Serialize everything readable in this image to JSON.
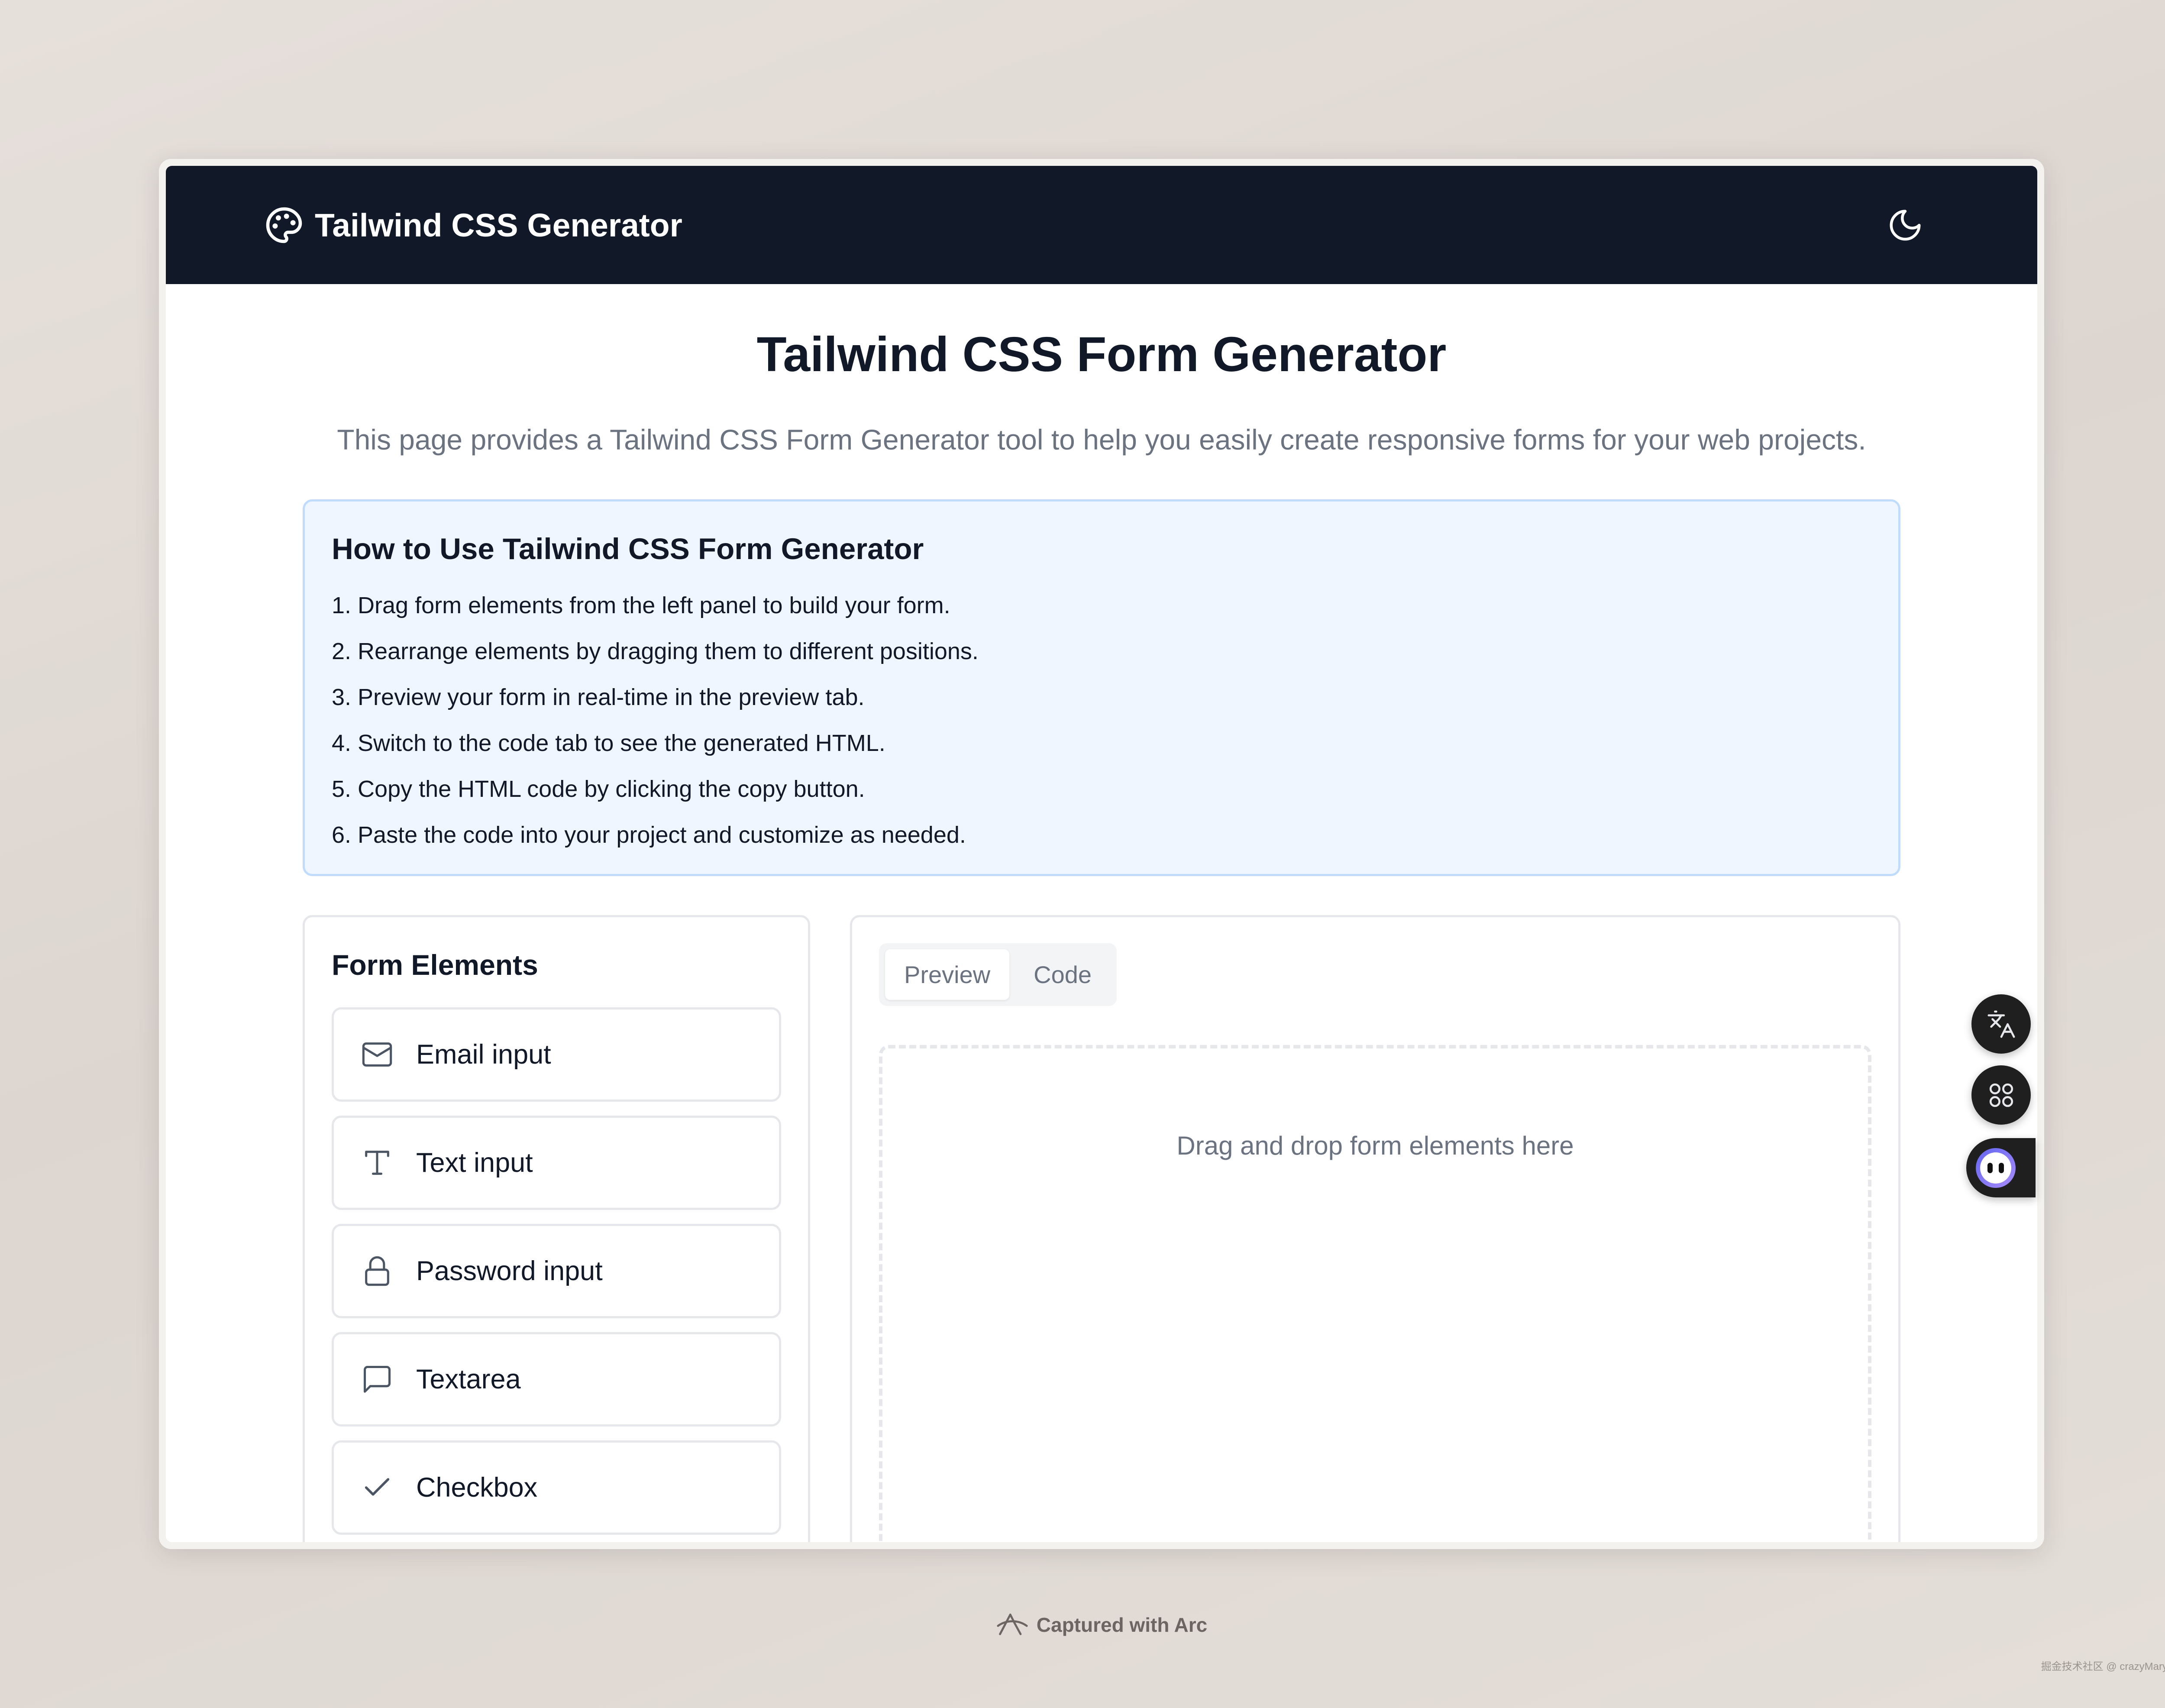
{
  "navbar": {
    "brand_icon": "palette-icon",
    "brand_title": "Tailwind CSS Generator",
    "theme_toggle_icon": "moon-icon",
    "background": "#111827"
  },
  "page": {
    "title": "Tailwind CSS Form Generator",
    "subtitle": "This page provides a Tailwind CSS Form Generator tool to help you easily create responsive forms for your web projects."
  },
  "howto": {
    "title": "How to Use Tailwind CSS Form Generator",
    "steps": [
      "1. Drag form elements from the left panel to build your form.",
      "2. Rearrange elements by dragging them to different positions.",
      "3. Preview your form in real-time in the preview tab.",
      "4. Switch to the code tab to see the generated HTML.",
      "5. Copy the HTML code by clicking the copy button.",
      "6. Paste the code into your project and customize as needed."
    ],
    "background": "#eff6ff",
    "border": "#bfdbfe"
  },
  "form_elements": {
    "title": "Form Elements",
    "items": [
      {
        "label": "Email input",
        "icon": "mail-icon"
      },
      {
        "label": "Text input",
        "icon": "text-type-icon"
      },
      {
        "label": "Password input",
        "icon": "lock-icon"
      },
      {
        "label": "Textarea",
        "icon": "message-square-icon"
      },
      {
        "label": "Checkbox",
        "icon": "check-icon"
      }
    ]
  },
  "editor": {
    "tabs": [
      {
        "label": "Preview",
        "active": true
      },
      {
        "label": "Code",
        "active": false
      }
    ],
    "dropzone_text": "Drag and drop form elements here"
  },
  "floating_buttons": [
    {
      "icon": "translate-icon"
    },
    {
      "icon": "apps-grid-icon"
    },
    {
      "icon": "assistant-avatar-icon"
    }
  ],
  "footer": {
    "captured_text": "Captured with Arc",
    "watermark": "掘金技术社区 @ crazyMary"
  }
}
